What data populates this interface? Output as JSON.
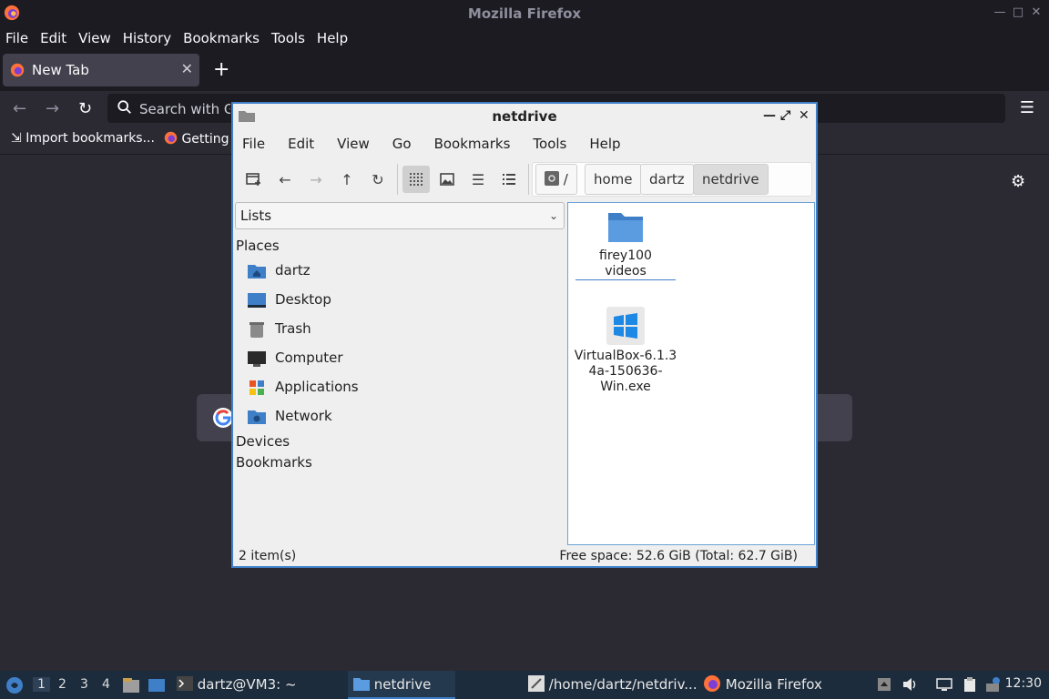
{
  "firefox": {
    "window_title": "Mozilla Firefox",
    "menu": [
      "File",
      "Edit",
      "View",
      "History",
      "Bookmarks",
      "Tools",
      "Help"
    ],
    "tab_label": "New Tab",
    "search_placeholder": "Search with Go",
    "bookmarks": [
      "Import bookmarks...",
      "Getting"
    ]
  },
  "netdrive": {
    "title": "netdrive",
    "menu": [
      "File",
      "Edit",
      "View",
      "Go",
      "Bookmarks",
      "Tools",
      "Help"
    ],
    "breadcrumb": [
      "/",
      "home",
      "dartz",
      "netdrive"
    ],
    "side_combo": "Lists",
    "sections": {
      "places": "Places",
      "devices": "Devices",
      "bookmarks": "Bookmarks"
    },
    "places": [
      "dartz",
      "Desktop",
      "Trash",
      "Computer",
      "Applications",
      "Network"
    ],
    "files": [
      {
        "name": "firey100 videos",
        "icon": "folder-icon"
      },
      {
        "name_lines": [
          "VirtualBox-6.1.3",
          "4a-150636-",
          "Win.exe"
        ],
        "icon": "windows-exe-icon"
      }
    ],
    "status_left": "2 item(s)",
    "status_right": "Free space: 52.6 GiB (Total: 62.7 GiB)"
  },
  "taskbar": {
    "workspaces": [
      "1",
      "2",
      "3",
      "4"
    ],
    "tasks": [
      "dartz@VM3: ~",
      "netdrive",
      "/home/dartz/netdriv...",
      "Mozilla Firefox"
    ],
    "clock": "12:30"
  },
  "colors": {
    "accent": "#3f7fc7",
    "ff_bg": "#2b2a33",
    "taskbar": "#1c2c3c"
  }
}
